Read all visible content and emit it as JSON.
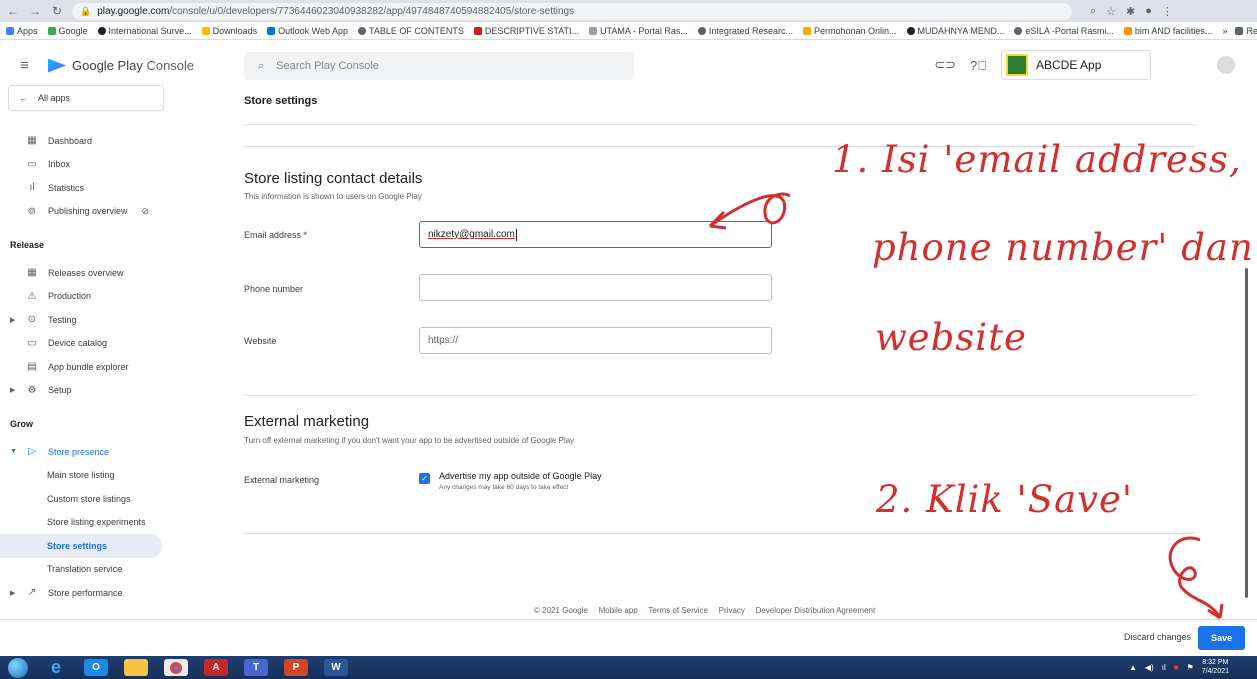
{
  "browser": {
    "url_host": "play.google.com",
    "url_path": "/console/u/0/developers/7736446023040938282/app/4974848740594882405/store-settings",
    "bookmarks": [
      "Apps",
      "Google",
      "International Surve...",
      "Downloads",
      "Outlook Web App",
      "TABLE OF CONTENTS",
      "DESCRIPTIVE STATI...",
      "UTAMA - Portal Ras...",
      "Integrated Researc...",
      "Permohonan Onlin...",
      "MUDAHNYA MEND...",
      "eSILA -Portal Rasmi...",
      "bim AND facilities..."
    ],
    "reading_list": "Reading list"
  },
  "header": {
    "brand_name": "Google Play",
    "brand_suffix": "Console",
    "search_placeholder": "Search Play Console",
    "app_name": "ABCDE App"
  },
  "sidebar": {
    "all_apps": "All apps",
    "items": [
      {
        "label": "Dashboard",
        "icon": "▦"
      },
      {
        "label": "Inbox",
        "icon": "▭"
      },
      {
        "label": "Statistics",
        "icon": "ıl"
      },
      {
        "label": "Publishing overview",
        "icon": "⊚"
      }
    ],
    "release_heading": "Release",
    "release_items": [
      {
        "label": "Releases overview",
        "icon": "▦"
      },
      {
        "label": "Production",
        "icon": "⚠"
      },
      {
        "label": "Testing",
        "icon": "⊙"
      },
      {
        "label": "Device catalog",
        "icon": "▭"
      },
      {
        "label": "App bundle explorer",
        "icon": "▤"
      },
      {
        "label": "Setup",
        "icon": "⚙"
      }
    ],
    "grow_heading": "Grow",
    "store_presence": "Store presence",
    "store_sub": [
      "Main store listing",
      "Custom store listings",
      "Store listing experiments",
      "Store settings",
      "Translation service"
    ],
    "store_performance": "Store performance"
  },
  "main": {
    "page_title": "Store settings",
    "contact_title": "Store listing contact details",
    "contact_sub": "This information is shown to users on Google Play",
    "email_label": "Email address *",
    "email_value": "nikzety@gmail.com",
    "phone_label": "Phone number",
    "website_label": "Website",
    "website_placeholder": "https://",
    "marketing_title": "External marketing",
    "marketing_sub": "Turn off external marketing if you don't want your app to be advertised outside of Google Play",
    "marketing_label": "External marketing",
    "marketing_checkbox": "Advertise my app outside of Google Play",
    "marketing_hint": "Any changes may take 60 days to take effect",
    "footer": [
      "© 2021 Google",
      "Mobile app",
      "Terms of Service",
      "Privacy",
      "Developer Distribution Agreement"
    ]
  },
  "actions": {
    "discard": "Discard changes",
    "save": "Save"
  },
  "annotations": {
    "line1": "1. Isi 'email address,",
    "line2": "phone number' dan",
    "line3": "website",
    "line4": "2. Klik 'Save'"
  },
  "taskbar": {
    "time": "8:32 PM",
    "date": "7/4/2021"
  },
  "colors": {
    "accent": "#1a73e8",
    "annotation": "#d32f2f"
  }
}
